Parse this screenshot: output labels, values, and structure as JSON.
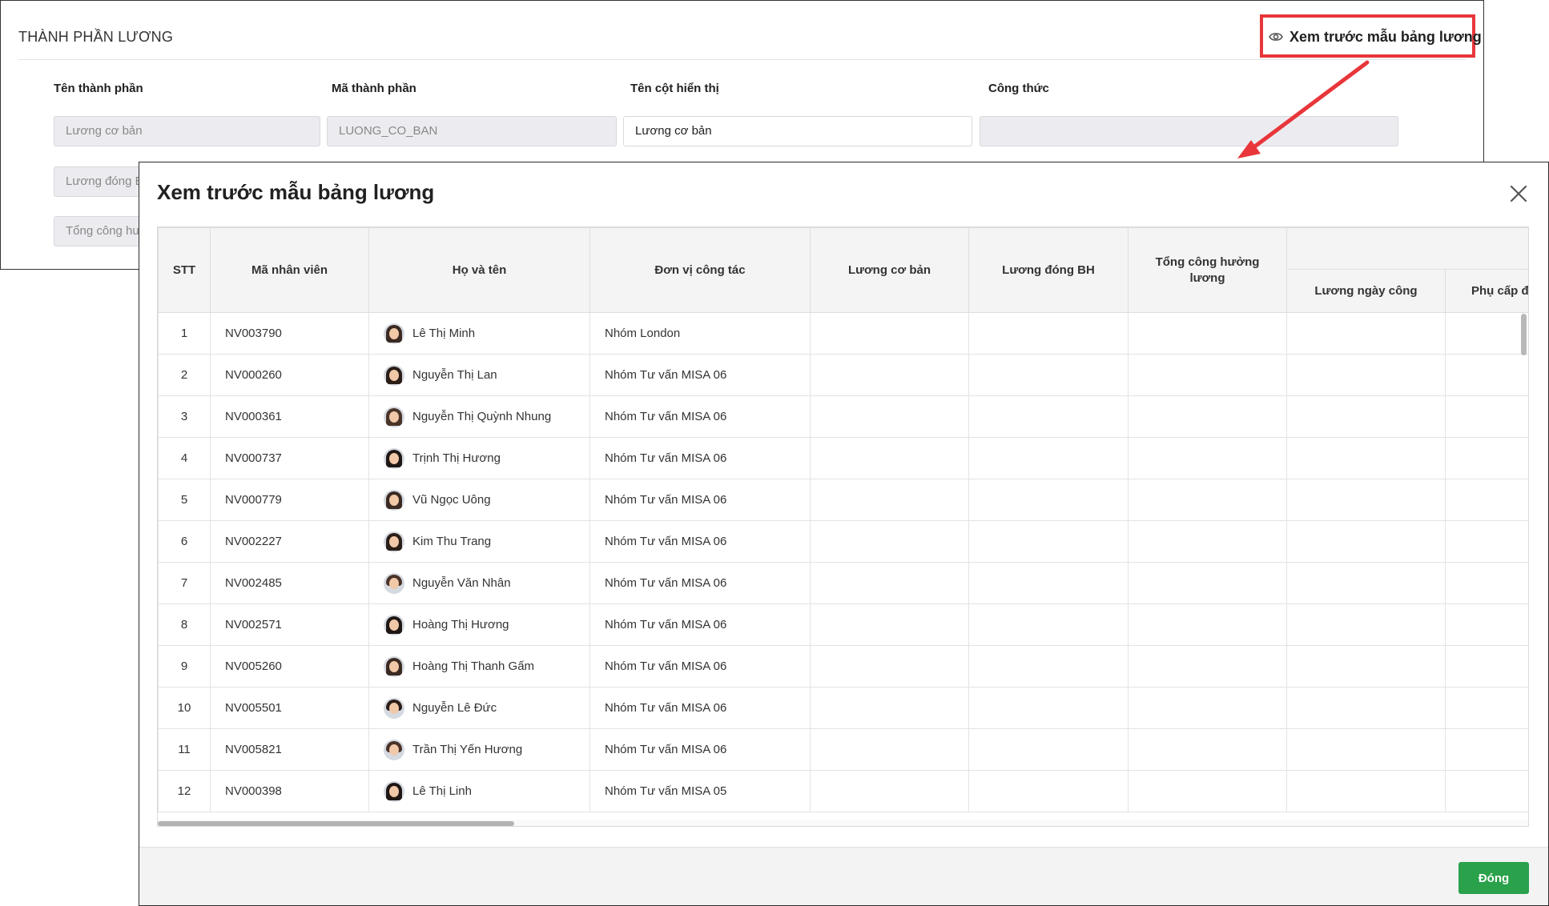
{
  "background_panel": {
    "title": "THÀNH PHẦN LƯƠNG",
    "columns": {
      "component_name": "Tên thành phần",
      "component_code": "Mã thành phần",
      "display_name": "Tên cột hiển thị",
      "formula": "Công thức"
    },
    "row1": {
      "component_name": "Lương cơ bản",
      "component_code": "LUONG_CO_BAN",
      "display_name": "Lương cơ bản",
      "formula": ""
    },
    "row2_component_name": "Lương đóng BH",
    "row3_component_name": "Tổng công hưởng lương",
    "preview_link": "Xem trước mẫu bảng lương"
  },
  "modal": {
    "title": "Xem trước mẫu bảng lương",
    "close_button": "Đóng",
    "headers": {
      "stt": "STT",
      "employee_code": "Mã nhân viên",
      "full_name": "Họ và tên",
      "unit": "Đơn vị công tác",
      "basic_salary": "Lương cơ bản",
      "insurance_salary": "Lương đóng BH",
      "total_paid_days": "Tổng công hưởng lương",
      "group": "",
      "daily_wage": "Lương ngày công",
      "allowance": "Phụ cấp đi lại"
    },
    "rows": [
      {
        "stt": "1",
        "code": "NV003790",
        "name": "Lê Thị Minh",
        "unit": "Nhóm London",
        "avatar": "female"
      },
      {
        "stt": "2",
        "code": "NV000260",
        "name": "Nguyễn Thị Lan",
        "unit": "Nhóm Tư vấn MISA 06",
        "avatar": "female"
      },
      {
        "stt": "3",
        "code": "NV000361",
        "name": "Nguyễn Thị Quỳnh Nhung",
        "unit": "Nhóm Tư vấn MISA 06",
        "avatar": "female"
      },
      {
        "stt": "4",
        "code": "NV000737",
        "name": "Trịnh Thị Hương",
        "unit": "Nhóm Tư vấn MISA 06",
        "avatar": "female"
      },
      {
        "stt": "5",
        "code": "NV000779",
        "name": "Vũ Ngọc Uông",
        "unit": "Nhóm Tư vấn MISA 06",
        "avatar": "female"
      },
      {
        "stt": "6",
        "code": "NV002227",
        "name": "Kim Thu Trang",
        "unit": "Nhóm Tư vấn MISA 06",
        "avatar": "female"
      },
      {
        "stt": "7",
        "code": "NV002485",
        "name": "Nguyễn Văn Nhân",
        "unit": "Nhóm Tư vấn MISA 06",
        "avatar": "male"
      },
      {
        "stt": "8",
        "code": "NV002571",
        "name": "Hoàng Thị Hương",
        "unit": "Nhóm Tư vấn MISA 06",
        "avatar": "female"
      },
      {
        "stt": "9",
        "code": "NV005260",
        "name": "Hoàng Thị Thanh Gấm",
        "unit": "Nhóm Tư vấn MISA 06",
        "avatar": "female"
      },
      {
        "stt": "10",
        "code": "NV005501",
        "name": "Nguyễn Lê Đức",
        "unit": "Nhóm Tư vấn MISA 06",
        "avatar": "male"
      },
      {
        "stt": "11",
        "code": "NV005821",
        "name": "Trần Thị Yến Hương",
        "unit": "Nhóm Tư vấn MISA 06",
        "avatar": "male"
      },
      {
        "stt": "12",
        "code": "NV000398",
        "name": "Lê Thị Linh",
        "unit": "Nhóm Tư vấn MISA 05",
        "avatar": "female"
      }
    ]
  },
  "colors": {
    "highlight": "#e8363a",
    "primary_button": "#2aa14b",
    "header_bg": "#f4f4f4"
  }
}
